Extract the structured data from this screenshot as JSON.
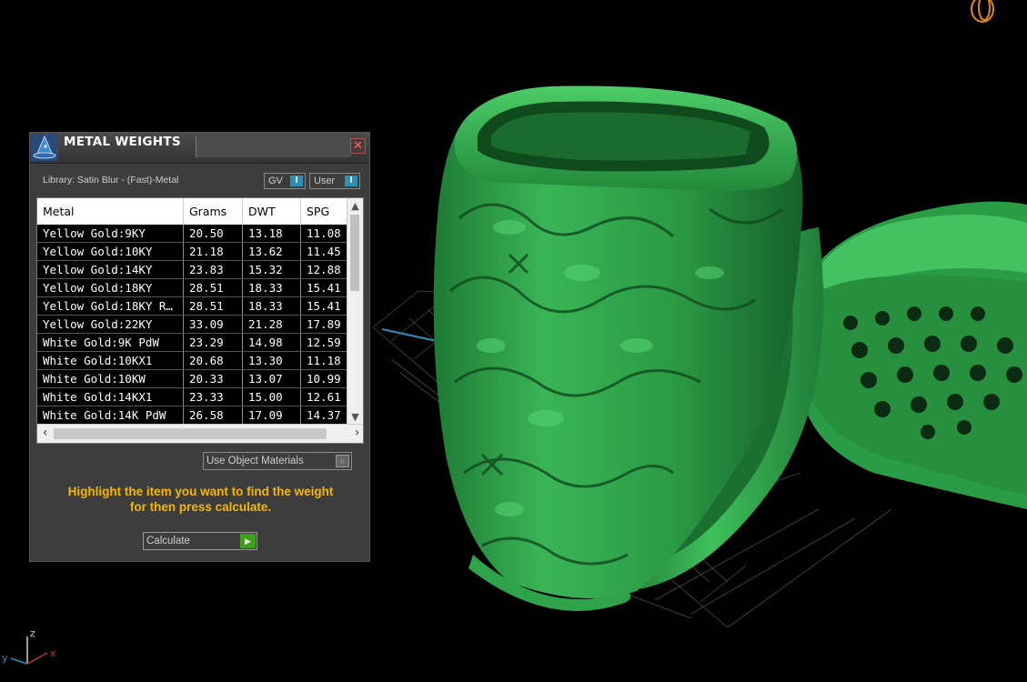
{
  "panel": {
    "title": "METAL WEIGHTS",
    "close_glyph": "✕",
    "library_label": "Library: Satin Blur - (Fast)-Metal",
    "gv_label": "GV",
    "user_label": "User",
    "toggle_glyph": "I",
    "columns": [
      "Metal",
      "Grams",
      "DWT",
      "SPG"
    ],
    "rows": [
      {
        "metal": "Yellow Gold:9KY",
        "grams": "20.50",
        "dwt": "13.18",
        "spg": "11.08"
      },
      {
        "metal": "Yellow Gold:10KY",
        "grams": "21.18",
        "dwt": "13.62",
        "spg": "11.45"
      },
      {
        "metal": "Yellow Gold:14KY",
        "grams": "23.83",
        "dwt": "15.32",
        "spg": "12.88"
      },
      {
        "metal": "Yellow Gold:18KY",
        "grams": "28.51",
        "dwt": "18.33",
        "spg": "15.41"
      },
      {
        "metal": "Yellow Gold:18KY R…",
        "grams": "28.51",
        "dwt": "18.33",
        "spg": "15.41"
      },
      {
        "metal": "Yellow Gold:22KY",
        "grams": "33.09",
        "dwt": "21.28",
        "spg": "17.89"
      },
      {
        "metal": "White Gold:9K PdW",
        "grams": "23.29",
        "dwt": "14.98",
        "spg": "12.59"
      },
      {
        "metal": "White Gold:10KX1",
        "grams": "20.68",
        "dwt": "13.30",
        "spg": "11.18"
      },
      {
        "metal": "White Gold:10KW",
        "grams": "20.33",
        "dwt": "13.07",
        "spg": "10.99"
      },
      {
        "metal": "White Gold:14KX1",
        "grams": "23.33",
        "dwt": "15.00",
        "spg": "12.61"
      },
      {
        "metal": "White Gold:14K PdW",
        "grams": "26.58",
        "dwt": "17.09",
        "spg": "14.37"
      }
    ],
    "use_object_materials_label": "Use Object Materials",
    "hint_line1": "Highlight the item you want to find the weight",
    "hint_line2": "for then press calculate.",
    "calculate_label": "Calculate"
  },
  "axes": {
    "x": "x",
    "y": "y",
    "z": "z"
  },
  "colors": {
    "accent": "#2e8fb5",
    "hint": "#f5b800",
    "model": "#2fa34a",
    "go": "#3f9f1e"
  }
}
